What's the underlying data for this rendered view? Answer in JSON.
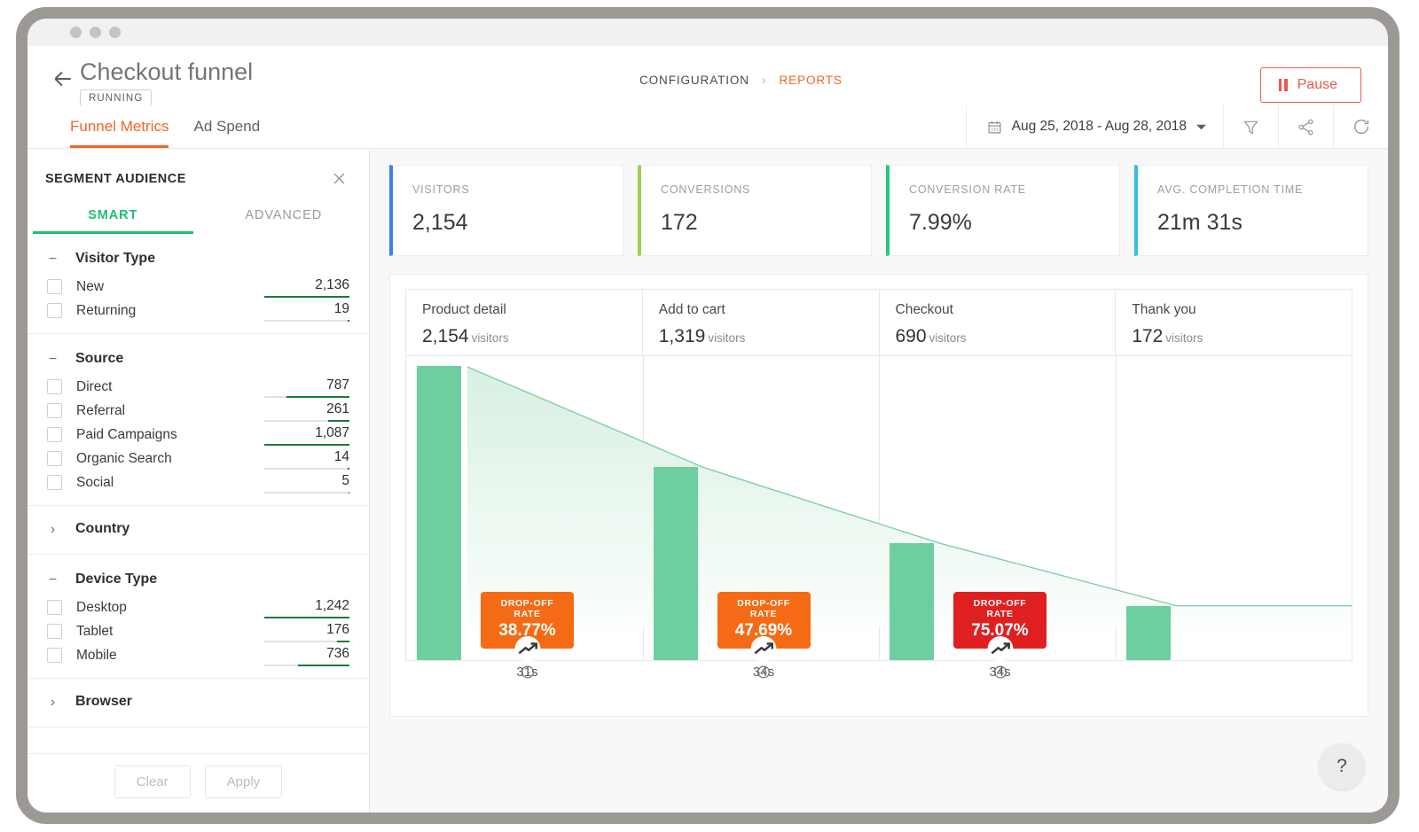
{
  "window": {
    "dots": [
      "dot-1",
      "dot-2",
      "dot-3"
    ]
  },
  "header": {
    "back_icon": "arrow-left-icon",
    "title": "Checkout funnel",
    "status": "RUNNING",
    "breadcrumb": [
      {
        "label": "CONFIGURATION",
        "active": false
      },
      {
        "label": "REPORTS",
        "active": true
      }
    ],
    "separator": "›",
    "pause_label": "Pause",
    "pause_color": "#e8584a"
  },
  "tabbar": {
    "tabs": [
      {
        "label": "Funnel Metrics",
        "active": true
      },
      {
        "label": "Ad Spend",
        "active": false
      }
    ],
    "date_range": "Aug 25, 2018 - Aug 28, 2018",
    "calendar_icon": "calendar-icon",
    "caret_icon": "chevron-down-icon",
    "tools": [
      {
        "icon": "filter-icon"
      },
      {
        "icon": "share-icon"
      },
      {
        "icon": "refresh-icon"
      }
    ]
  },
  "sidebar": {
    "title": "SEGMENT AUDIENCE",
    "close_icon": "close-icon",
    "tabs": [
      {
        "label": "SMART",
        "active": true
      },
      {
        "label": "ADVANCED",
        "active": false
      }
    ],
    "accent": "#1dbf73",
    "groups": [
      {
        "name": "Visitor Type",
        "expanded": true,
        "toggle": "−",
        "items": [
          {
            "label": "New",
            "value": "2,136",
            "bar_pct": 100,
            "bar_offset": 0
          },
          {
            "label": "Returning",
            "value": "19",
            "bar_pct": 2,
            "bar_offset": 98
          }
        ]
      },
      {
        "name": "Source",
        "expanded": true,
        "toggle": "−",
        "items": [
          {
            "label": "Direct",
            "value": "787",
            "bar_pct": 74,
            "bar_offset": 26
          },
          {
            "label": "Referral",
            "value": "261",
            "bar_pct": 25,
            "bar_offset": 75
          },
          {
            "label": "Paid Campaigns",
            "value": "1,087",
            "bar_pct": 100,
            "bar_offset": 0
          },
          {
            "label": "Organic Search",
            "value": "14",
            "bar_pct": 2,
            "bar_offset": 98
          },
          {
            "label": "Social",
            "value": "5",
            "bar_pct": 1,
            "bar_offset": 99
          }
        ]
      },
      {
        "name": "Country",
        "expanded": false,
        "toggle": "›",
        "items": []
      },
      {
        "name": "Device Type",
        "expanded": true,
        "toggle": "−",
        "items": [
          {
            "label": "Desktop",
            "value": "1,242",
            "bar_pct": 100,
            "bar_offset": 0
          },
          {
            "label": "Tablet",
            "value": "176",
            "bar_pct": 15,
            "bar_offset": 85
          },
          {
            "label": "Mobile",
            "value": "736",
            "bar_pct": 60,
            "bar_offset": 40
          }
        ]
      },
      {
        "name": "Browser",
        "expanded": false,
        "toggle": "›",
        "items": []
      }
    ],
    "clear_label": "Clear",
    "apply_label": "Apply"
  },
  "kpis": [
    {
      "label": "VISITORS",
      "value": "2,154",
      "color": "#3d7ff0"
    },
    {
      "label": "CONVERSIONS",
      "value": "172",
      "color": "#9ad04f"
    },
    {
      "label": "CONVERSION RATE",
      "value": "7.99%",
      "color": "#25c97a"
    },
    {
      "label": "AVG. COMPLETION TIME",
      "value": "21m 31s",
      "color": "#32bfe6"
    }
  ],
  "chart_data": {
    "type": "bar",
    "title": "Checkout funnel",
    "categories": [
      "Product detail",
      "Add to cart",
      "Checkout",
      "Thank you"
    ],
    "values": [
      2154,
      1319,
      690,
      172
    ],
    "value_labels": [
      "2,154",
      "1,319",
      "690",
      "172"
    ],
    "unit": "visitors",
    "ylim": [
      0,
      2154
    ],
    "grid": false,
    "legend": null,
    "bar_color": "#6dcf9f",
    "area_fill": "#e8f7ef",
    "drop_offs": [
      {
        "label": "DROP-OFF RATE",
        "value": "38.77%",
        "color": "#f56a14",
        "time": "31s",
        "from": "Product detail",
        "to": "Add to cart"
      },
      {
        "label": "DROP-OFF RATE",
        "value": "47.69%",
        "color": "#f56a14",
        "time": "34s",
        "from": "Add to cart",
        "to": "Checkout"
      },
      {
        "label": "DROP-OFF RATE",
        "value": "75.07%",
        "color": "#e02020",
        "time": "34s",
        "from": "Checkout",
        "to": "Thank you"
      }
    ],
    "trend_icon": "trend-up-icon",
    "clock_icon": "clock-icon"
  },
  "help": {
    "label": "?",
    "icon": "help-icon"
  }
}
